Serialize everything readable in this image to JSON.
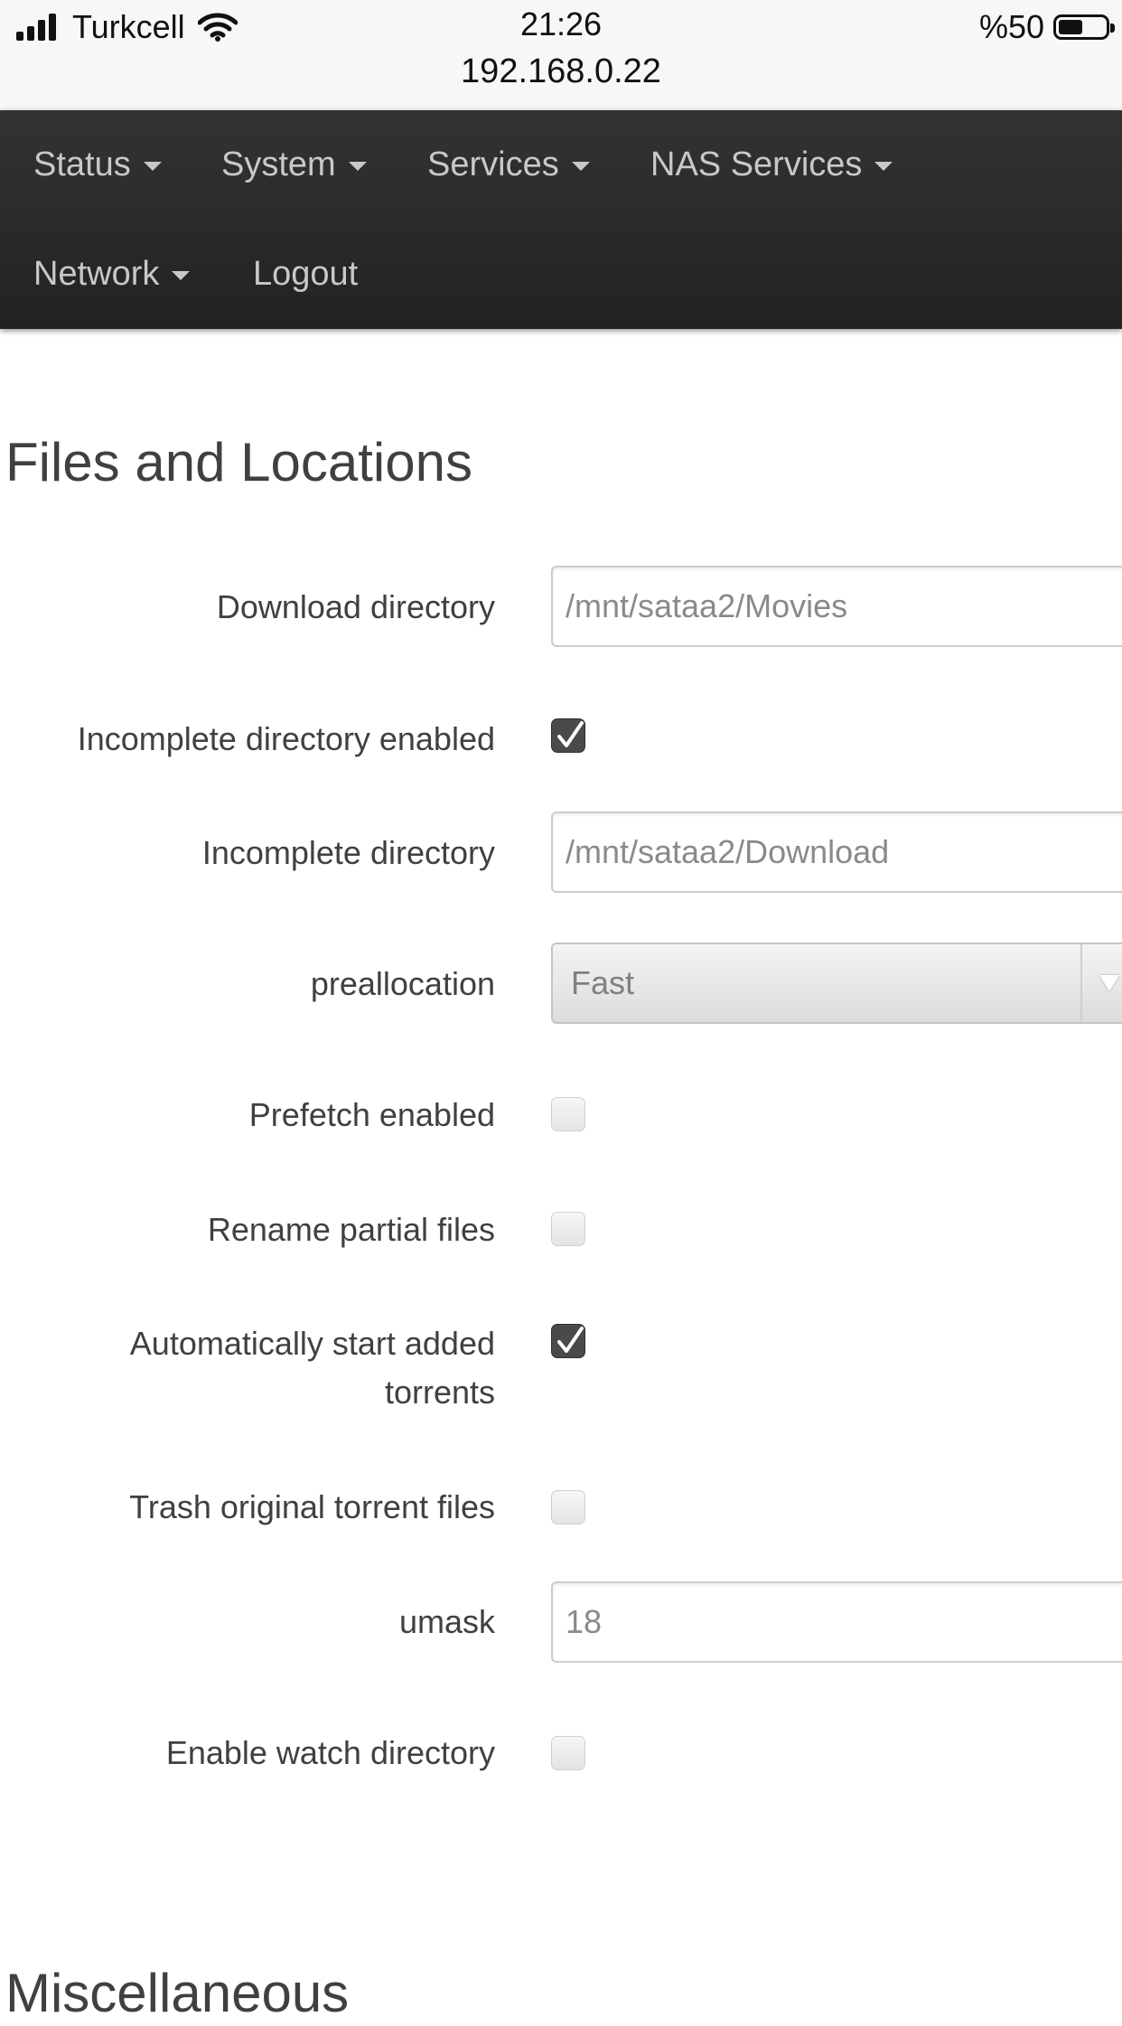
{
  "status_bar": {
    "carrier": "Turkcell",
    "time": "21:26",
    "url": "192.168.0.22",
    "battery": "%50"
  },
  "nav": {
    "items": [
      {
        "label": "Status",
        "dropdown": true
      },
      {
        "label": "System",
        "dropdown": true
      },
      {
        "label": "Services",
        "dropdown": true
      },
      {
        "label": "NAS Services",
        "dropdown": true
      },
      {
        "label": "Network",
        "dropdown": true
      },
      {
        "label": "Logout",
        "dropdown": false
      }
    ]
  },
  "section": {
    "title": "Files and Locations",
    "fields": {
      "download_directory": {
        "label": "Download directory",
        "placeholder": "/mnt/sataa2/Movies"
      },
      "incomplete_directory_enabled": {
        "label": "Incomplete directory enabled",
        "checked": true
      },
      "incomplete_directory": {
        "label": "Incomplete directory",
        "placeholder": "/mnt/sataa2/Download"
      },
      "preallocation": {
        "label": "preallocation",
        "value": "Fast"
      },
      "prefetch_enabled": {
        "label": "Prefetch enabled",
        "checked": false
      },
      "rename_partial_files": {
        "label": "Rename partial files",
        "checked": false
      },
      "auto_start_added_torrents": {
        "label": "Automatically start added torrents",
        "checked": true
      },
      "trash_original_torrent_files": {
        "label": "Trash original torrent files",
        "checked": false
      },
      "umask": {
        "label": "umask",
        "placeholder": "18"
      },
      "enable_watch_directory": {
        "label": "Enable watch directory",
        "checked": false
      }
    }
  },
  "next_section": {
    "title": "Miscellaneous"
  },
  "colors": {
    "navbar": "#2a2a2a",
    "nav_text": "#c8c8c8",
    "label_text": "#404040",
    "checkbox_checked": "#4a4a4a"
  }
}
